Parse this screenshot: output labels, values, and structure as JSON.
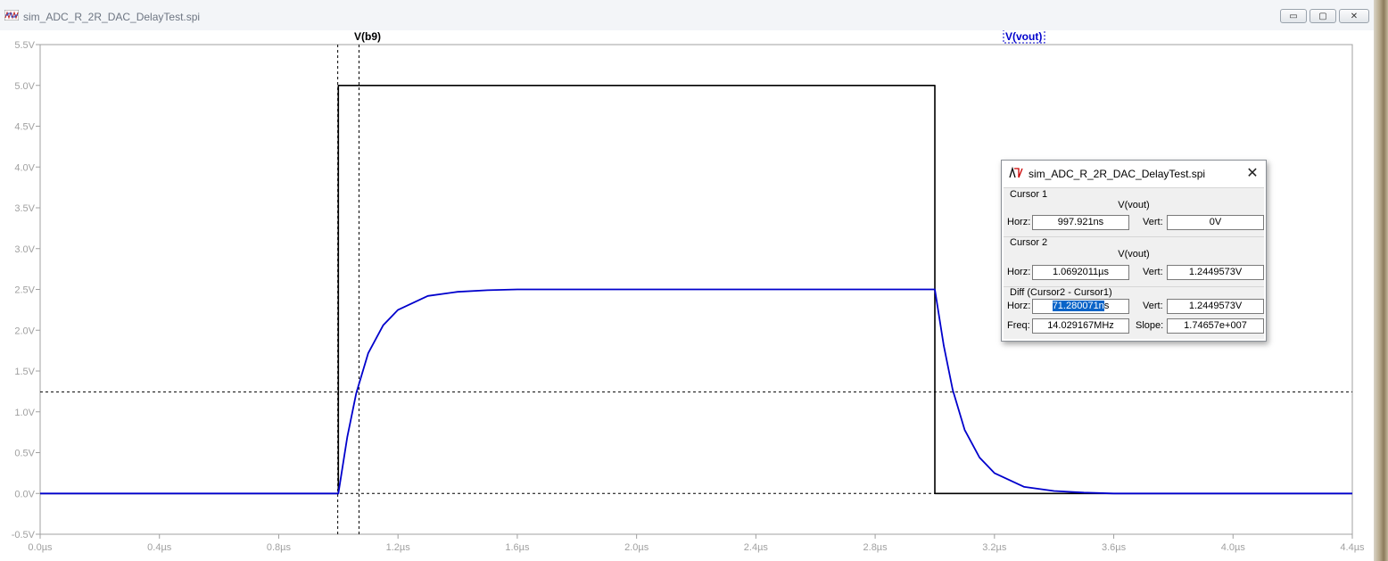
{
  "window": {
    "title": "sim_ADC_R_2R_DAC_DelayTest.spi",
    "buttons": {
      "minimize": "▭",
      "maximize": "▢",
      "close": "✕"
    }
  },
  "chart_data": {
    "type": "line",
    "xlabel": "",
    "ylabel": "",
    "xlim": [
      0.0,
      4.4
    ],
    "ylim": [
      -0.5,
      5.5
    ],
    "x_unit": "µs",
    "x_tick_labels": [
      "0.0µs",
      "0.4µs",
      "0.8µs",
      "1.2µs",
      "1.6µs",
      "2.0µs",
      "2.4µs",
      "2.8µs",
      "3.2µs",
      "3.6µs",
      "4.0µs",
      "4.4µs"
    ],
    "y_tick_labels": [
      "5.5V",
      "5.0V",
      "4.5V",
      "4.0V",
      "3.5V",
      "3.0V",
      "2.5V",
      "2.0V",
      "1.5V",
      "1.0V",
      "0.5V",
      "0.0V",
      "-0.5V"
    ],
    "series": [
      {
        "name": "V(b9)",
        "color": "#000000",
        "x": [
          0.0,
          1.0,
          1.0,
          3.0,
          3.0,
          4.4
        ],
        "y": [
          0.0,
          0.0,
          5.0,
          5.0,
          0.0,
          0.0
        ]
      },
      {
        "name": "V(vout)",
        "color": "#0000cc",
        "x": [
          0.0,
          1.0,
          1.03,
          1.06,
          1.1,
          1.15,
          1.2,
          1.3,
          1.4,
          1.5,
          1.6,
          2.0,
          3.0,
          3.03,
          3.06,
          3.1,
          3.15,
          3.2,
          3.3,
          3.4,
          3.5,
          3.6,
          4.4
        ],
        "y": [
          0.0,
          0.0,
          0.69,
          1.23,
          1.72,
          2.06,
          2.25,
          2.42,
          2.47,
          2.49,
          2.5,
          2.5,
          2.5,
          1.81,
          1.27,
          0.78,
          0.44,
          0.25,
          0.08,
          0.03,
          0.01,
          0.0,
          0.0
        ]
      }
    ],
    "cursors": {
      "vertical_x": [
        0.997921,
        1.0692011
      ],
      "horizontal_y": [
        0.0,
        1.2449573
      ]
    }
  },
  "cursor_dialog": {
    "title": "sim_ADC_R_2R_DAC_DelayTest.spi",
    "close": "✕",
    "cursor1": {
      "label": "Cursor 1",
      "trace": "V(vout)",
      "horz_label": "Horz:",
      "horz": "997.921ns",
      "vert_label": "Vert:",
      "vert": "0V"
    },
    "cursor2": {
      "label": "Cursor 2",
      "trace": "V(vout)",
      "horz_label": "Horz:",
      "horz": "1.0692011µs",
      "vert_label": "Vert:",
      "vert": "1.2449573V"
    },
    "diff": {
      "label": "Diff (Cursor2 - Cursor1)",
      "horz_label": "Horz:",
      "horz_selected": "71.280071n",
      "horz_rest": "s",
      "vert_label": "Vert:",
      "vert": "1.2449573V",
      "freq_label": "Freq:",
      "freq": "14.029167MHz",
      "slope_label": "Slope:",
      "slope": "1.74657e+007"
    }
  }
}
